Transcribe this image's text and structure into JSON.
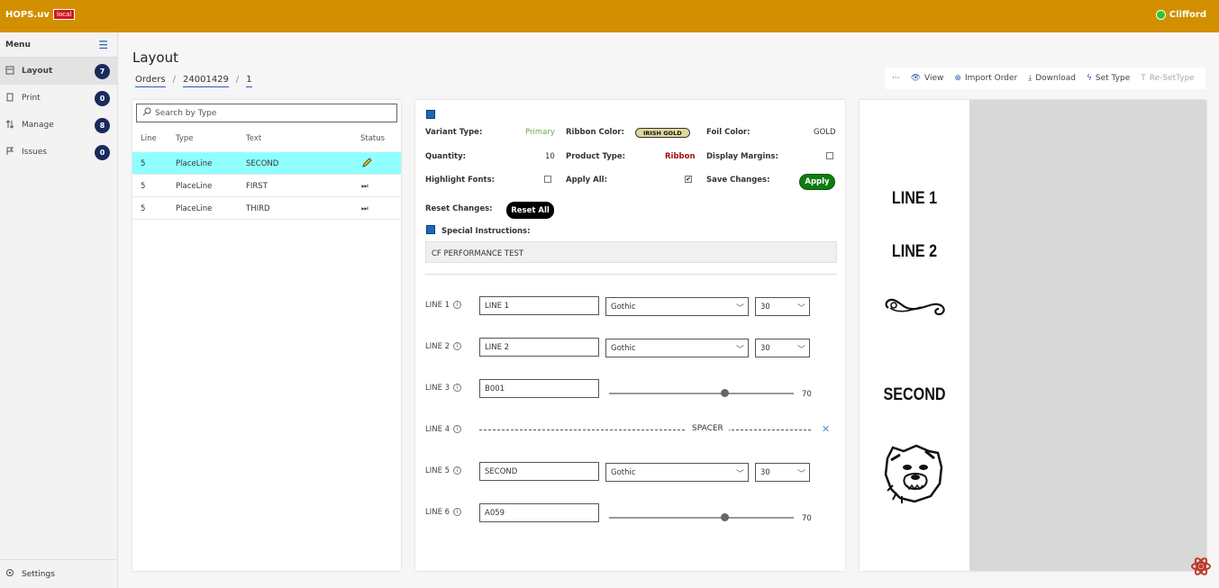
{
  "app": {
    "title": "HOPS.uv",
    "env": "local",
    "user": "Clifford"
  },
  "sidebar": {
    "menu_label": "Menu",
    "items": [
      {
        "label": "Layout",
        "count": "7"
      },
      {
        "label": "Print",
        "count": "0"
      },
      {
        "label": "Manage",
        "count": "8"
      },
      {
        "label": "Issues",
        "count": "0"
      }
    ],
    "settings_label": "Settings"
  },
  "page": {
    "title": "Layout",
    "breadcrumb": [
      "Orders",
      "24001429",
      "1"
    ]
  },
  "toolbar": {
    "more": "···",
    "view": "View",
    "import": "Import Order",
    "download": "Download",
    "set_type": "Set Type",
    "reset_type": "Re-SetType"
  },
  "list": {
    "search_placeholder": "Search by Type",
    "headers": [
      "Line",
      "Type",
      "Text",
      "Status"
    ],
    "rows": [
      {
        "line": "5",
        "type": "PlaceLine",
        "text": "SECOND",
        "status": "edit-icon"
      },
      {
        "line": "5",
        "type": "PlaceLine",
        "text": "FIRST",
        "status": "skip-icon"
      },
      {
        "line": "5",
        "type": "PlaceLine",
        "text": "THIRD",
        "status": "skip-icon"
      }
    ]
  },
  "details": {
    "variant_type_label": "Variant Type:",
    "variant_type": "Primary",
    "ribbon_color_label": "Ribbon Color:",
    "ribbon_color": "IRISH GOLD",
    "foil_color_label": "Foil Color:",
    "foil_color": "GOLD",
    "quantity_label": "Quantity:",
    "quantity": "10",
    "product_type_label": "Product Type:",
    "product_type": "Ribbon",
    "display_margins_label": "Display Margins:",
    "highlight_fonts_label": "Highlight Fonts:",
    "apply_all_label": "Apply All:",
    "save_changes_label": "Save Changes:",
    "apply_button": "Apply",
    "reset_changes_label": "Reset Changes:",
    "reset_button": "Reset All",
    "special_instructions_label": "Special Instructions:",
    "special_instructions": "CF PERFORMANCE TEST"
  },
  "lines": [
    {
      "label": "LINE 1",
      "kind": "text",
      "value": "LINE 1",
      "font": "Gothic",
      "size": "30"
    },
    {
      "label": "LINE 2",
      "kind": "text",
      "value": "LINE 2",
      "font": "Gothic",
      "size": "30"
    },
    {
      "label": "LINE 3",
      "kind": "graphic",
      "value": "B001",
      "slider": "70"
    },
    {
      "label": "LINE 4",
      "kind": "spacer",
      "value": "SPACER"
    },
    {
      "label": "LINE 5",
      "kind": "text",
      "value": "SECOND",
      "font": "Gothic",
      "size": "30"
    },
    {
      "label": "LINE 6",
      "kind": "graphic",
      "value": "A059",
      "slider": "70"
    }
  ],
  "preview": {
    "line1": "LINE 1",
    "line2": "LINE 2",
    "line5": "SECOND"
  },
  "colors": {
    "topbar": "#d29000",
    "accent": "#1a69b5",
    "badge": "#1a2a5c",
    "apply": "#0f7b0f",
    "selected_row": "#8fffff"
  }
}
